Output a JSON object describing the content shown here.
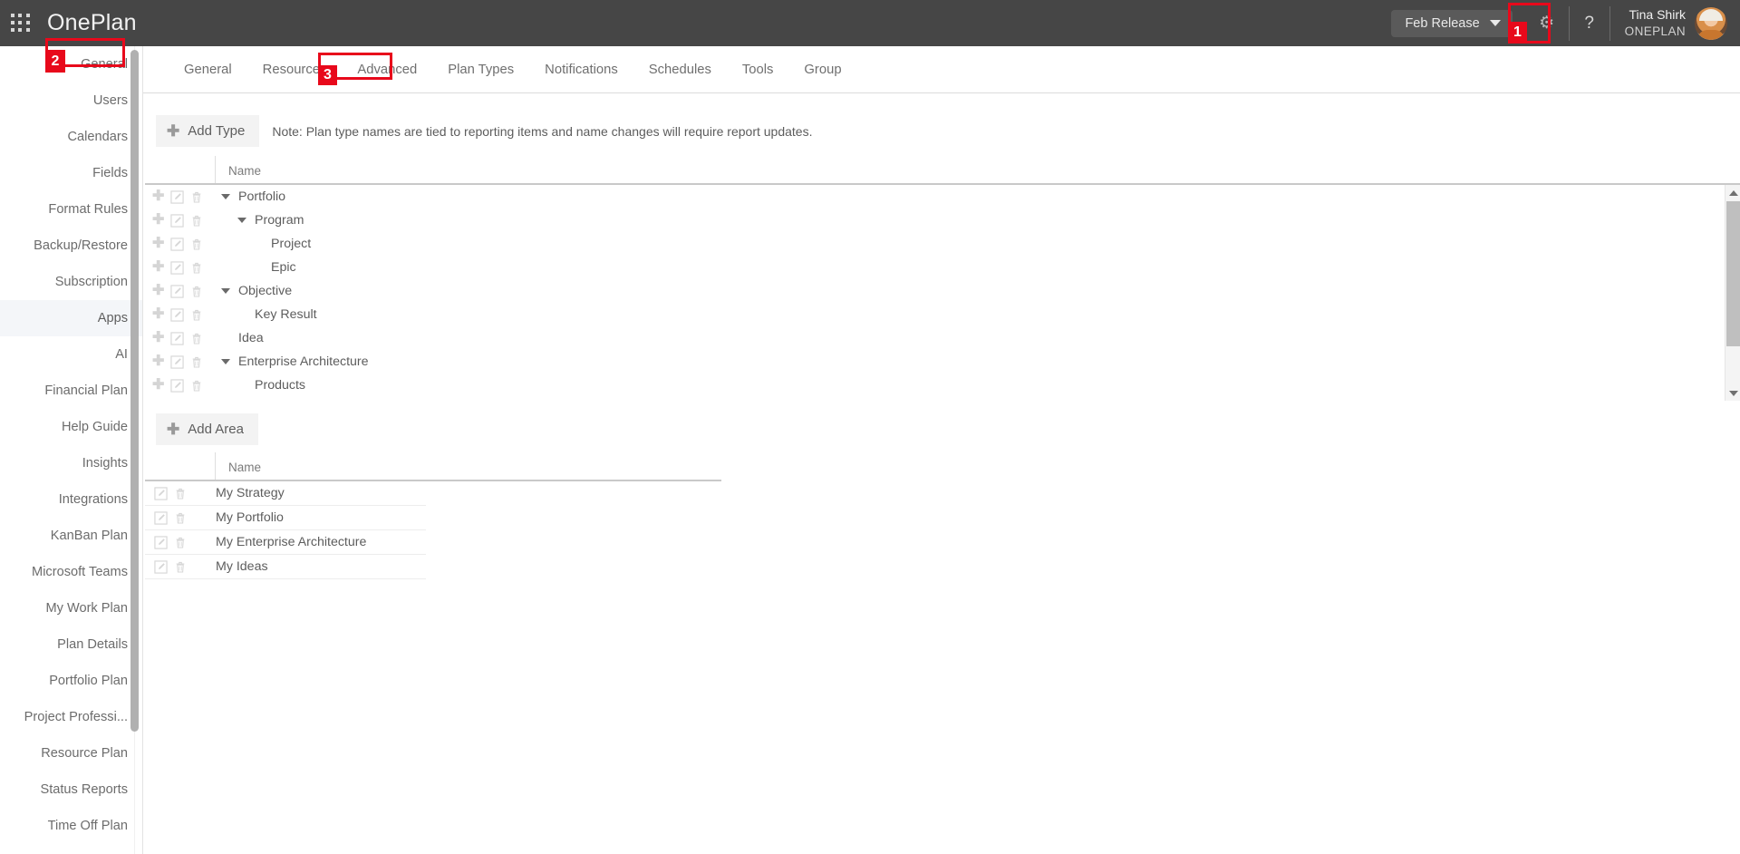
{
  "header": {
    "app_title": "OnePlan",
    "waffle_icon": "grid-menu-icon",
    "release_label": "Feb Release",
    "gear_icon": "gear-icon",
    "help_icon": "question-mark-icon",
    "user_name": "Tina Shirk",
    "user_org": "ONEPLAN",
    "avatar_icon": "user-avatar"
  },
  "annotations": [
    {
      "number": "1",
      "target": "settings-gear"
    },
    {
      "number": "2",
      "target": "sidebar-general"
    },
    {
      "number": "3",
      "target": "tab-plan-types"
    }
  ],
  "sidebar": {
    "items": [
      {
        "label": "General",
        "active": false
      },
      {
        "label": "Users",
        "active": false
      },
      {
        "label": "Calendars",
        "active": false
      },
      {
        "label": "Fields",
        "active": false
      },
      {
        "label": "Format Rules",
        "active": false
      },
      {
        "label": "Backup/Restore",
        "active": false
      },
      {
        "label": "Subscription",
        "active": false
      },
      {
        "label": "Apps",
        "active": true
      },
      {
        "label": "AI",
        "active": false
      },
      {
        "label": "Financial Plan",
        "active": false
      },
      {
        "label": "Help Guide",
        "active": false
      },
      {
        "label": "Insights",
        "active": false
      },
      {
        "label": "Integrations",
        "active": false
      },
      {
        "label": "KanBan Plan",
        "active": false
      },
      {
        "label": "Microsoft Teams",
        "active": false
      },
      {
        "label": "My Work Plan",
        "active": false
      },
      {
        "label": "Plan Details",
        "active": false
      },
      {
        "label": "Portfolio Plan",
        "active": false
      },
      {
        "label": "Project Professi...",
        "active": false
      },
      {
        "label": "Resource Plan",
        "active": false
      },
      {
        "label": "Status Reports",
        "active": false
      },
      {
        "label": "Time Off Plan",
        "active": false
      }
    ]
  },
  "tabs": [
    {
      "label": "General",
      "active": false
    },
    {
      "label": "Resources",
      "active": false
    },
    {
      "label": "Advanced",
      "active": false
    },
    {
      "label": "Plan Types",
      "active": true
    },
    {
      "label": "Notifications",
      "active": false
    },
    {
      "label": "Schedules",
      "active": false
    },
    {
      "label": "Tools",
      "active": false
    },
    {
      "label": "Group",
      "active": false
    }
  ],
  "plan_types": {
    "add_button": "Add Type",
    "note": "Note: Plan type names are tied to reporting items and name changes will require report updates.",
    "column_name": "Name",
    "rows": [
      {
        "name": "Portfolio",
        "level": 0,
        "expandable": true
      },
      {
        "name": "Program",
        "level": 1,
        "expandable": true
      },
      {
        "name": "Project",
        "level": 2,
        "expandable": false
      },
      {
        "name": "Epic",
        "level": 2,
        "expandable": false
      },
      {
        "name": "Objective",
        "level": 0,
        "expandable": true
      },
      {
        "name": "Key Result",
        "level": 1,
        "expandable": false
      },
      {
        "name": "Idea",
        "level": 0,
        "expandable": false
      },
      {
        "name": "Enterprise Architecture",
        "level": 0,
        "expandable": true
      },
      {
        "name": "Products",
        "level": 1,
        "expandable": false
      }
    ]
  },
  "areas": {
    "add_button": "Add Area",
    "column_name": "Name",
    "rows": [
      {
        "name": "My Strategy"
      },
      {
        "name": "My Portfolio"
      },
      {
        "name": "My Enterprise Architecture"
      },
      {
        "name": "My Ideas"
      }
    ]
  },
  "icons": {
    "add": "plus-icon",
    "edit": "edit-pencil-icon",
    "delete": "trash-icon",
    "expand": "chevron-down-icon"
  },
  "colors": {
    "topbar": "#464646",
    "annotation": "#e8091b",
    "active_sidebar": "#f4f6f9"
  }
}
